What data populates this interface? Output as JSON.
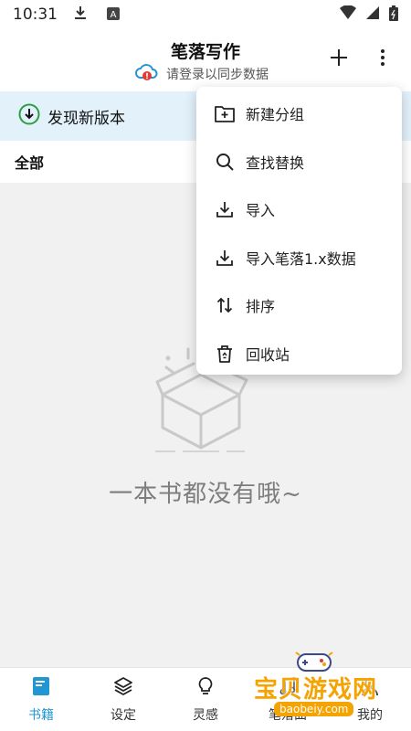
{
  "status_bar": {
    "time": "10:31"
  },
  "app_bar": {
    "title": "笔落写作",
    "sync_hint": "请登录以同步数据"
  },
  "update_banner": {
    "label": "发现新版本"
  },
  "group": {
    "label": "全部"
  },
  "empty_state": {
    "message": "一本书都没有哦~"
  },
  "menu": {
    "items": [
      {
        "label": "新建分组",
        "icon": "folder-add-icon"
      },
      {
        "label": "查找替换",
        "icon": "search-icon"
      },
      {
        "label": "导入",
        "icon": "download-icon"
      },
      {
        "label": "导入笔落1.x数据",
        "icon": "download-icon"
      },
      {
        "label": "排序",
        "icon": "sort-icon"
      },
      {
        "label": "回收站",
        "icon": "recycle-bin-icon"
      }
    ]
  },
  "bottom_nav": {
    "items": [
      {
        "label": "书籍",
        "icon": "book-icon",
        "active": true
      },
      {
        "label": "设定",
        "icon": "layers-icon",
        "active": false
      },
      {
        "label": "灵感",
        "icon": "lightbulb-icon",
        "active": false
      },
      {
        "label": "笔落曲",
        "icon": "music-icon",
        "active": false
      },
      {
        "label": "我的",
        "icon": "user-icon",
        "active": false
      }
    ]
  },
  "watermark": {
    "title": "宝贝游戏网",
    "url": "baobeiy.com"
  },
  "colors": {
    "accent": "#2196d3",
    "banner_bg": "#e3f1fb",
    "update_icon": "#2e9e45",
    "watermark": "#f5a300"
  }
}
